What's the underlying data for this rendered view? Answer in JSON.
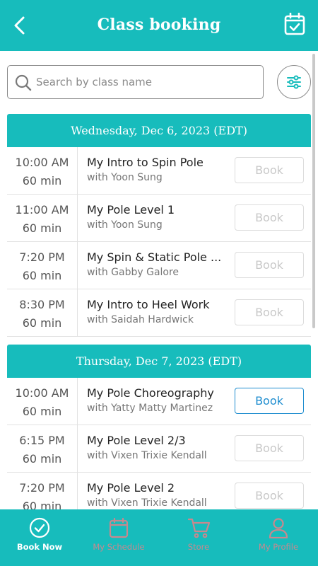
{
  "header": {
    "title": "Class booking"
  },
  "search": {
    "placeholder": "Search by class name"
  },
  "days": [
    {
      "label": "Wednesday, Dec 6, 2023 (EDT)",
      "classes": [
        {
          "time": "10:00  AM",
          "duration": "60 min",
          "name": "My Intro to Spin Pole",
          "instructor": "with Yoon Sung",
          "book": "Book",
          "active": false
        },
        {
          "time": "11:00  AM",
          "duration": "60 min",
          "name": "My Pole Level 1",
          "instructor": "with Yoon Sung",
          "book": "Book",
          "active": false
        },
        {
          "time": "7:20  PM",
          "duration": "60 min",
          "name": "My Spin & Static Pole ...",
          "instructor": "with Gabby Galore",
          "book": "Book",
          "active": false
        },
        {
          "time": "8:30  PM",
          "duration": "60 min",
          "name": "My Intro to Heel Work",
          "instructor": "with Saidah Hardwick",
          "book": "Book",
          "active": false
        }
      ]
    },
    {
      "label": "Thursday, Dec 7, 2023 (EDT)",
      "classes": [
        {
          "time": "10:00  AM",
          "duration": "60 min",
          "name": "My Pole Choreography",
          "instructor": "with Yatty Matty Martinez",
          "book": "Book",
          "active": true
        },
        {
          "time": "6:15  PM",
          "duration": "60 min",
          "name": "My Pole Level 2/3",
          "instructor": "with Vixen Trixie Kendall",
          "book": "Book",
          "active": false
        },
        {
          "time": "7:20  PM",
          "duration": "60 min",
          "name": "My Pole Level 2",
          "instructor": "with Vixen Trixie Kendall",
          "book": "Book",
          "active": false
        }
      ]
    }
  ],
  "tabs": [
    {
      "label": "Book Now",
      "icon": "check-circle-icon",
      "selected": true
    },
    {
      "label": "My Schedule",
      "icon": "calendar-icon",
      "selected": false
    },
    {
      "label": "Store",
      "icon": "cart-icon",
      "selected": false
    },
    {
      "label": "My Profile",
      "icon": "person-icon",
      "selected": false
    }
  ],
  "colors": {
    "brand": "#17bcbc",
    "bookActive": "#1e8dcf",
    "tabDim": "#c9888e"
  }
}
